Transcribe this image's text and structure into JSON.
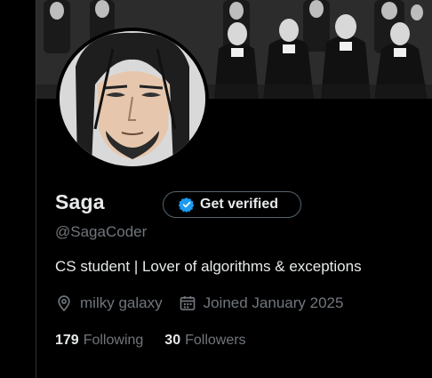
{
  "profile": {
    "name": "Saga",
    "handle": "@SagaCoder",
    "bio": "CS student | Lover of algorithms & exceptions",
    "location": "milky galaxy",
    "joined": "Joined January 2025",
    "verify_button_label": "Get verified"
  },
  "stats": {
    "following_count": "179",
    "following_label": "Following",
    "followers_count": "30",
    "followers_label": "Followers"
  },
  "icons": {
    "verify": "verified-badge-icon",
    "location": "location-pin-icon",
    "calendar": "calendar-icon"
  },
  "colors": {
    "background": "#000000",
    "primary_text": "#e7e9ea",
    "secondary_text": "#71767b",
    "border": "#536471",
    "verified_blue": "#1d9bf0"
  }
}
